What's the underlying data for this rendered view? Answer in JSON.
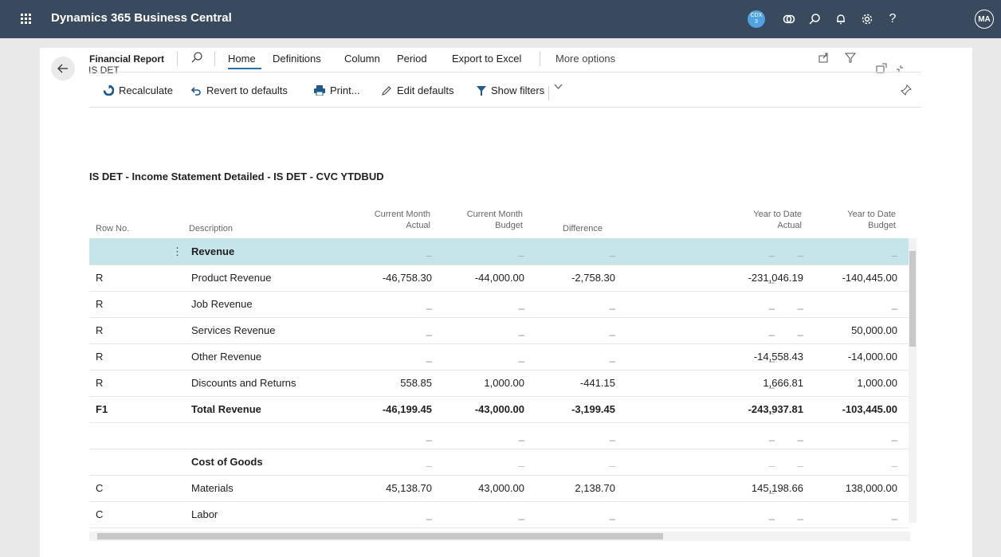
{
  "app": {
    "title": "Dynamics 365 Business Central",
    "company_badge": "CDX\n3",
    "avatar_initials": "MA"
  },
  "page": {
    "title": "IS DET"
  },
  "actions": {
    "group_label": "Financial Report",
    "tabs": [
      "Home",
      "Definitions",
      "Column",
      "Period",
      "Export to Excel"
    ],
    "more": "More options"
  },
  "commands": {
    "recalculate": "Recalculate",
    "revert": "Revert to defaults",
    "print": "Print...",
    "edit_defaults": "Edit defaults",
    "show_filters": "Show filters"
  },
  "report": {
    "title": "IS DET - Income Statement Detailed - IS DET - CVC YTDBUD"
  },
  "table": {
    "headers": {
      "row_no": "Row No.",
      "description": "Description",
      "cm_actual_1": "Current Month",
      "cm_actual_2": "Actual",
      "cm_budget_1": "Current Month",
      "cm_budget_2": "Budget",
      "difference": "Difference",
      "ytd_actual_1": "Year to Date",
      "ytd_actual_2": "Actual",
      "ytd_budget_1": "Year to Date",
      "ytd_budget_2": "Budget"
    },
    "rows": [
      {
        "row_no": "",
        "desc": "Revenue",
        "cma": "_",
        "cmb": "_",
        "diff": "_",
        "blank": "_",
        "ytda": "_",
        "ytdb": "_"
      },
      {
        "row_no": "R",
        "desc": "Product Revenue",
        "cma": "-46,758.30",
        "cmb": "-44,000.00",
        "diff": "-2,758.30",
        "blank": "_",
        "ytda": "-231,046.19",
        "ytdb": "-140,445.00"
      },
      {
        "row_no": "R",
        "desc": "Job Revenue",
        "cma": "_",
        "cmb": "_",
        "diff": "_",
        "blank": "_",
        "ytda": "_",
        "ytdb": "_"
      },
      {
        "row_no": "R",
        "desc": "Services Revenue",
        "cma": "_",
        "cmb": "_",
        "diff": "_",
        "blank": "_",
        "ytda": "_",
        "ytdb": "50,000.00"
      },
      {
        "row_no": "R",
        "desc": "Other Revenue",
        "cma": "_",
        "cmb": "_",
        "diff": "_",
        "blank": "_",
        "ytda": "-14,558.43",
        "ytdb": "-14,000.00"
      },
      {
        "row_no": "R",
        "desc": "Discounts and Returns",
        "cma": "558.85",
        "cmb": "1,000.00",
        "diff": "-441.15",
        "blank": "_",
        "ytda": "1,666.81",
        "ytdb": "1,000.00"
      },
      {
        "row_no": "F1",
        "desc": "Total Revenue",
        "cma": "-46,199.45",
        "cmb": "-43,000.00",
        "diff": "-3,199.45",
        "blank": "_",
        "ytda": "-243,937.81",
        "ytdb": "-103,445.00"
      },
      {
        "row_no": "",
        "desc": "",
        "cma": "_",
        "cmb": "_",
        "diff": "_",
        "blank": "_",
        "ytda": "_",
        "ytdb": "_"
      },
      {
        "row_no": "",
        "desc": "Cost of Goods",
        "cma": "_",
        "cmb": "_",
        "diff": "_",
        "blank": "_",
        "ytda": "_",
        "ytdb": "_"
      },
      {
        "row_no": "C",
        "desc": "Materials",
        "cma": "45,138.70",
        "cmb": "43,000.00",
        "diff": "2,138.70",
        "blank": "_",
        "ytda": "145,198.66",
        "ytdb": "138,000.00"
      },
      {
        "row_no": "C",
        "desc": "Labor",
        "cma": "_",
        "cmb": "_",
        "diff": "_",
        "blank": "_",
        "ytda": "_",
        "ytdb": "_"
      }
    ]
  }
}
